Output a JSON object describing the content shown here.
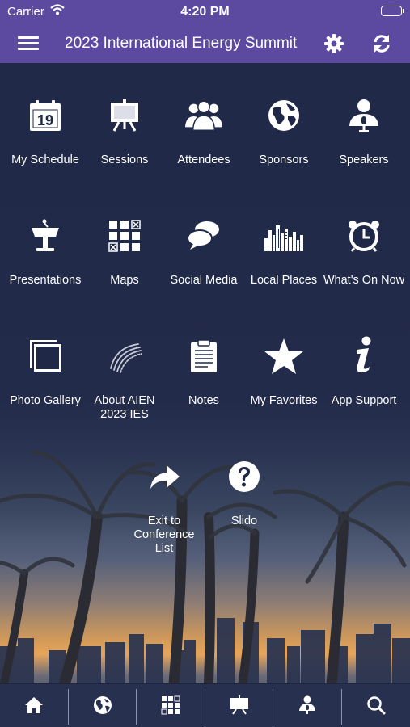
{
  "status_bar": {
    "carrier": "Carrier",
    "time": "4:20 PM"
  },
  "header": {
    "title": "2023 International Energy Summit"
  },
  "tiles": [
    {
      "label": "My Schedule",
      "icon": "calendar-icon",
      "calendar_day": "19"
    },
    {
      "label": "Sessions",
      "icon": "easel-icon"
    },
    {
      "label": "Attendees",
      "icon": "people-icon"
    },
    {
      "label": "Sponsors",
      "icon": "globe-icon"
    },
    {
      "label": "Speakers",
      "icon": "speaker-icon"
    },
    {
      "label": "Presentations",
      "icon": "podium-icon"
    },
    {
      "label": "Maps",
      "icon": "map-grid-icon"
    },
    {
      "label": "Social Media",
      "icon": "chat-bubbles-icon"
    },
    {
      "label": "Local Places",
      "icon": "city-skyline-icon"
    },
    {
      "label": "What's On Now",
      "icon": "alarm-clock-icon"
    },
    {
      "label": "Photo Gallery",
      "icon": "photo-gallery-icon"
    },
    {
      "label": "About AIEN 2023 IES",
      "icon": "aien-logo-icon"
    },
    {
      "label": "Notes",
      "icon": "clipboard-icon"
    },
    {
      "label": "My Favorites",
      "icon": "star-icon"
    },
    {
      "label": "App Support",
      "icon": "info-icon"
    },
    {
      "label": "Exit to Conference List",
      "icon": "exit-arrow-icon"
    },
    {
      "label": "Slido",
      "icon": "question-icon"
    }
  ],
  "bottom_tabs": [
    {
      "name": "home",
      "icon": "home-icon"
    },
    {
      "name": "sponsors",
      "icon": "globe-icon"
    },
    {
      "name": "maps",
      "icon": "map-grid-icon"
    },
    {
      "name": "sessions",
      "icon": "easel-icon"
    },
    {
      "name": "speakers",
      "icon": "speaker-icon"
    },
    {
      "name": "search",
      "icon": "search-icon"
    }
  ]
}
